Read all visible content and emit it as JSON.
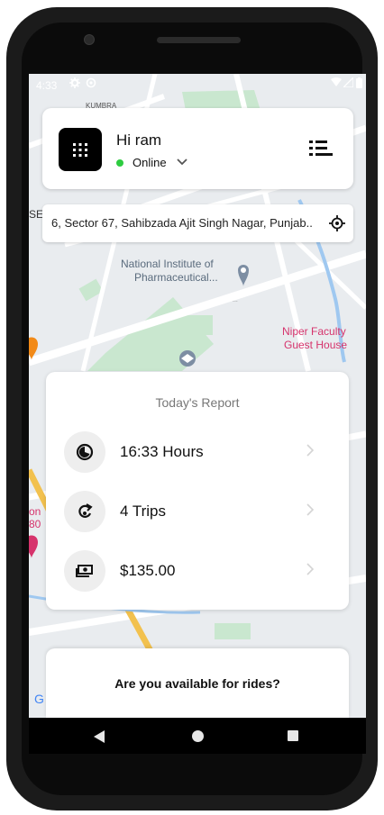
{
  "status_bar": {
    "time": "4:33",
    "icons": [
      "settings-icon",
      "sync-icon",
      "wifi-icon",
      "signal-icon",
      "battery-icon"
    ]
  },
  "map": {
    "labels": {
      "kumbra": "KUMBRA",
      "sector_edge": "SE",
      "niper_line1": "National Institute of",
      "niper_line2": "Pharmaceutical...",
      "niper_ellipsis": "...",
      "guest_line1": "Niper Faculty",
      "guest_line2": "Guest House",
      "left_edge_1": "on",
      "left_edge_2": "80",
      "google_fragment": "G"
    },
    "colors": {
      "land": "#e9ecef",
      "park": "#c9e7cf",
      "road": "#ffffff",
      "water": "#9fc8f0",
      "poi_pink": "#d6336c"
    }
  },
  "header": {
    "greeting": "Hi ram",
    "status": "Online",
    "status_color": "#2ecc40"
  },
  "address": {
    "text": "6, Sector 67, Sahibzada Ajit Singh Nagar, Punjab..",
    "locate_icon": "crosshair-icon"
  },
  "report": {
    "title": "Today's Report",
    "rows": [
      {
        "icon": "timer-icon",
        "label": "16:33 Hours"
      },
      {
        "icon": "route-icon",
        "label": "4 Trips"
      },
      {
        "icon": "cash-icon",
        "label": "$135.00"
      }
    ]
  },
  "availability": {
    "question": "Are you available for rides?"
  },
  "nav_bar": {
    "icons": [
      "back-icon",
      "home-icon",
      "recents-icon"
    ]
  }
}
